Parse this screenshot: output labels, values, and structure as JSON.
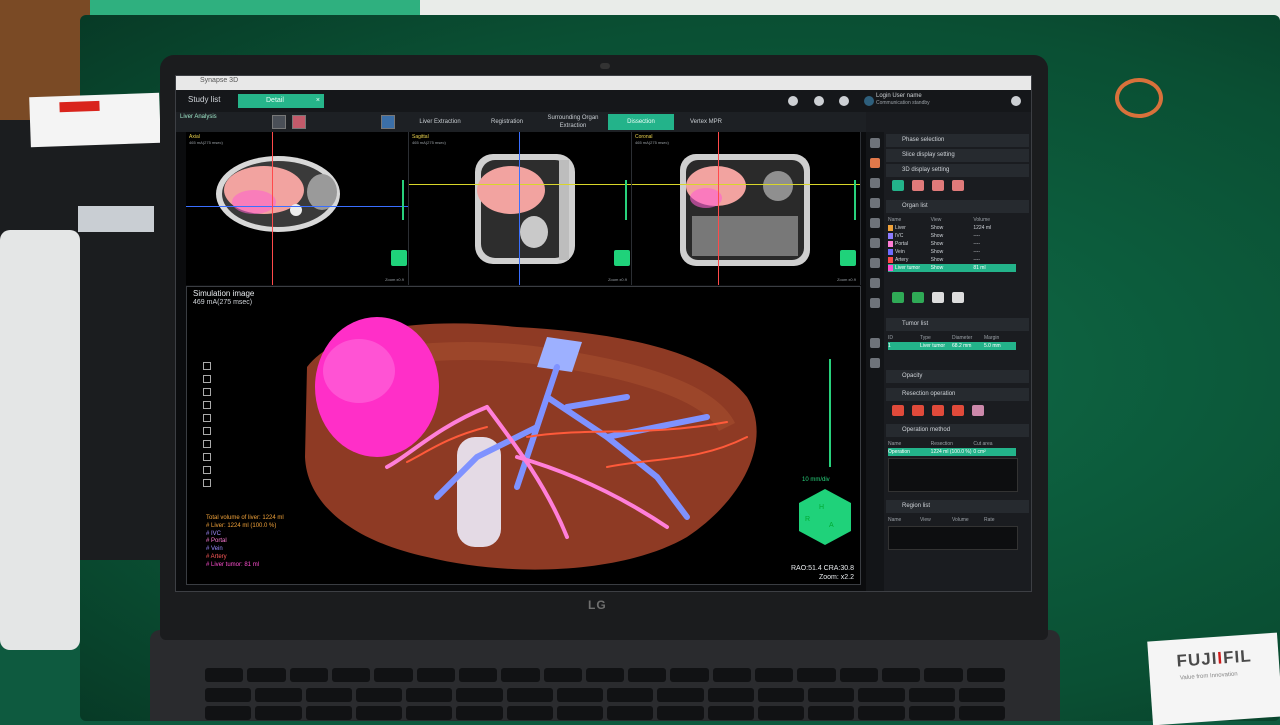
{
  "app": {
    "window_title": "Synapse 3D",
    "study_list_label": "Study list",
    "active_study_tab": "Detail",
    "close_glyph": "×",
    "login_user": "Login User name",
    "login_info": "Communication standby"
  },
  "workflow": {
    "analysis_label": "Liver Analysis",
    "tabs": [
      {
        "label": "Liver Extraction"
      },
      {
        "label": "Registration"
      },
      {
        "label": "Surrounding Organ Extraction"
      },
      {
        "label": "Dissection"
      },
      {
        "label": "Vertex MPR"
      }
    ],
    "active_tab_index": 3
  },
  "mpr_views": [
    {
      "header": "Axial",
      "sub": "465 mA(275 msec)",
      "zoom": "Zoom x0.9"
    },
    {
      "header": "Sagittal",
      "sub": "465 mA(275 msec)",
      "zoom": "Zoom x0.9"
    },
    {
      "header": "Coronal",
      "sub": "465 mA(275 msec)",
      "zoom": "Zoom x0.9"
    }
  ],
  "view3d": {
    "title": "Simulation image",
    "subtitle": "469 mA(275 msec)",
    "scale_label": "10 mm/div",
    "orientation": "RAO:51.4 CRA:30.8",
    "zoom": "Zoom: x2.2",
    "legend": [
      {
        "text": "Total volume of liver: 1224 ml",
        "color": "#f0a23a"
      },
      {
        "text": "# Liver: 1224 ml (100.0 %)",
        "color": "#f0a23a"
      },
      {
        "text": "# IVC",
        "color": "#a18bff"
      },
      {
        "text": "# Portal",
        "color": "#ff7cd5"
      },
      {
        "text": "# Vein",
        "color": "#9a8bff"
      },
      {
        "text": "# Artery",
        "color": "#ff5a5a"
      },
      {
        "text": "# Liver tumor: 81 ml",
        "color": "#ff4fd1"
      }
    ]
  },
  "right_panel": {
    "sections": {
      "phase_selection": "Phase selection",
      "slice_display": "Slice display setting",
      "display_3d": "3D display setting",
      "organ_list": "Organ list",
      "tumor_list": "Tumor list",
      "opacity": "Opacity",
      "resection": "Resection operation",
      "operation_method": "Operation method",
      "region_list": "Region list"
    },
    "organ_table": {
      "headers": [
        "Name",
        "View",
        "Volume"
      ],
      "rows": [
        {
          "name": "Liver",
          "view": "Show",
          "volume": "1224 ml",
          "color": "#f0a23a"
        },
        {
          "name": "IVC",
          "view": "Show",
          "volume": "----",
          "color": "#8e7cff"
        },
        {
          "name": "Portal",
          "view": "Show",
          "volume": "----",
          "color": "#ff7cd5"
        },
        {
          "name": "Vein",
          "view": "Show",
          "volume": "----",
          "color": "#6f6cff"
        },
        {
          "name": "Artery",
          "view": "Show",
          "volume": "----",
          "color": "#ff4a4a"
        },
        {
          "name": "Liver tumor",
          "view": "Show",
          "volume": "81 ml",
          "color": "#ff4fd1"
        }
      ],
      "selected_index": 5
    },
    "tumor_table": {
      "headers": [
        "ID",
        "Type",
        "Diameter",
        "Margin"
      ],
      "rows": [
        {
          "id": "1",
          "type": "Liver tumor",
          "diameter": "68.2 mm",
          "margin": "5.0 mm"
        }
      ]
    },
    "operation_table": {
      "headers": [
        "Name",
        "Resection",
        "Cut area"
      ],
      "rows": [
        {
          "name": "Operation",
          "resection": "1224 ml (100.0 %)",
          "cut_area": "0 cm²"
        }
      ]
    },
    "region_table": {
      "headers": [
        "Name",
        "View",
        "Volume",
        "Rate"
      ]
    }
  },
  "colors": {
    "accent": "#23b38a",
    "liver": "#a0452c",
    "tumor": "#ff2fc8",
    "portal": "#8aa2ff",
    "artery": "#ff4f3a"
  },
  "background": {
    "laptop_brand": "LG",
    "card_brand_prefix": "FUJI",
    "card_brand_suffix": "FIL",
    "card_tagline": "Value from Innovation"
  }
}
